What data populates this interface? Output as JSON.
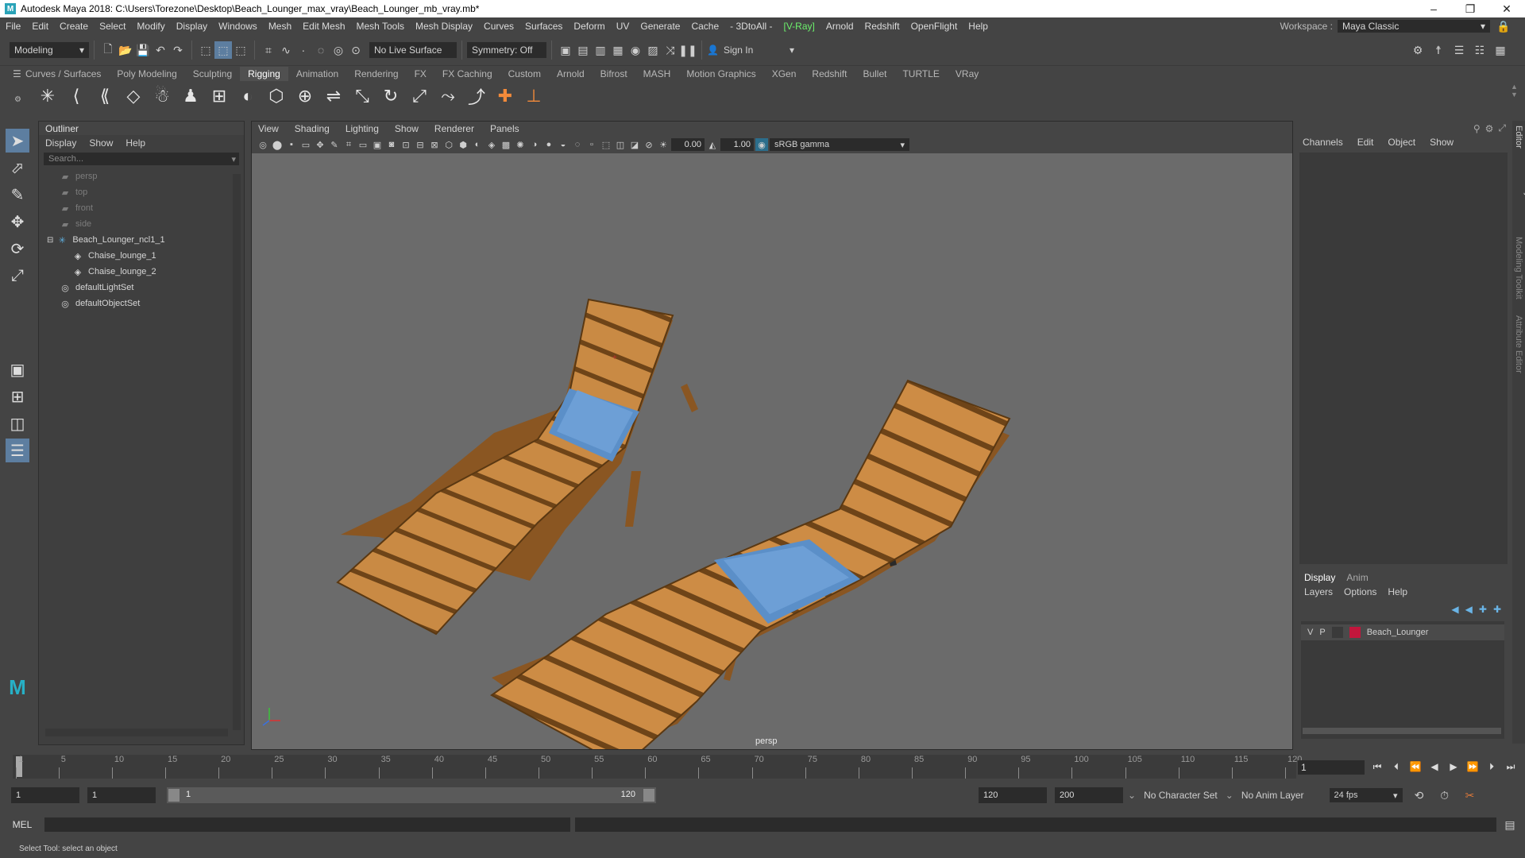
{
  "window": {
    "title": "Autodesk Maya 2018: C:\\Users\\Torezone\\Desktop\\Beach_Lounger_max_vray\\Beach_Lounger_mb_vray.mb*"
  },
  "menu": [
    "File",
    "Edit",
    "Create",
    "Select",
    "Modify",
    "Display",
    "Windows",
    "Mesh",
    "Edit Mesh",
    "Mesh Tools",
    "Mesh Display",
    "Curves",
    "Surfaces",
    "Deform",
    "UV",
    "Generate",
    "Cache",
    "- 3DtoAll -",
    "[V-Ray]",
    "Arnold",
    "Redshift",
    "OpenFlight",
    "Help"
  ],
  "workspace": {
    "label": "Workspace :",
    "value": "Maya Classic"
  },
  "statusline": {
    "mode": "Modeling",
    "live_surface": "No Live Surface",
    "symmetry": "Symmetry: Off",
    "sign_in": "Sign In"
  },
  "shelf": {
    "tabs": [
      "Curves / Surfaces",
      "Poly Modeling",
      "Sculpting",
      "Rigging",
      "Animation",
      "Rendering",
      "FX",
      "FX Caching",
      "Custom",
      "Arnold",
      "Bifrost",
      "MASH",
      "Motion Graphics",
      "XGen",
      "Redshift",
      "Bullet",
      "TURTLE",
      "VRay"
    ],
    "active": "Rigging"
  },
  "outliner": {
    "title": "Outliner",
    "menu": [
      "Display",
      "Show",
      "Help"
    ],
    "search_placeholder": "Search...",
    "items": [
      {
        "label": "persp",
        "icon": "camera-icon",
        "dim": true,
        "indent": 0
      },
      {
        "label": "top",
        "icon": "camera-icon",
        "dim": true,
        "indent": 0
      },
      {
        "label": "front",
        "icon": "camera-icon",
        "dim": true,
        "indent": 0
      },
      {
        "label": "side",
        "icon": "camera-icon",
        "dim": true,
        "indent": 0
      },
      {
        "label": "Beach_Lounger_ncl1_1",
        "icon": "group-icon",
        "dim": false,
        "indent": 0,
        "expand": "⊟"
      },
      {
        "label": "Chaise_lounge_1",
        "icon": "mesh-icon",
        "dim": false,
        "indent": 1
      },
      {
        "label": "Chaise_lounge_2",
        "icon": "mesh-icon",
        "dim": false,
        "indent": 1
      },
      {
        "label": "defaultLightSet",
        "icon": "set-icon",
        "dim": false,
        "indent": 0
      },
      {
        "label": "defaultObjectSet",
        "icon": "set-icon",
        "dim": false,
        "indent": 0
      }
    ]
  },
  "viewport": {
    "menu": [
      "View",
      "Shading",
      "Lighting",
      "Show",
      "Renderer",
      "Panels"
    ],
    "exposure": "0.00",
    "gamma": "1.00",
    "color_space": "sRGB gamma",
    "camera": "persp"
  },
  "channelbox": {
    "menu": [
      "Channels",
      "Edit",
      "Object",
      "Show"
    ],
    "layer_tabs": [
      "Display",
      "Anim"
    ],
    "layer_menu": [
      "Layers",
      "Options",
      "Help"
    ],
    "layer": {
      "v": "V",
      "p": "P",
      "name": "Beach_Lounger",
      "color": "#c2163c"
    },
    "side_tabs": [
      "Channel Box / Layer Editor",
      "Modeling Toolkit",
      "Attribute Editor"
    ]
  },
  "timeline": {
    "ticks": [
      "1",
      "5",
      "10",
      "15",
      "20",
      "25",
      "30",
      "35",
      "40",
      "45",
      "50",
      "55",
      "60",
      "65",
      "70",
      "75",
      "80",
      "85",
      "90",
      "95",
      "100",
      "105",
      "110",
      "115",
      "120"
    ],
    "current_frame": "1"
  },
  "range": {
    "start": "1",
    "playback_start": "1",
    "slider_start": "1",
    "slider_end": "120",
    "playback_end": "120",
    "end": "200",
    "character_set": "No Character Set",
    "anim_layer": "No Anim Layer",
    "fps": "24 fps"
  },
  "command": {
    "label": "MEL"
  },
  "help_line": "Select Tool: select an object"
}
